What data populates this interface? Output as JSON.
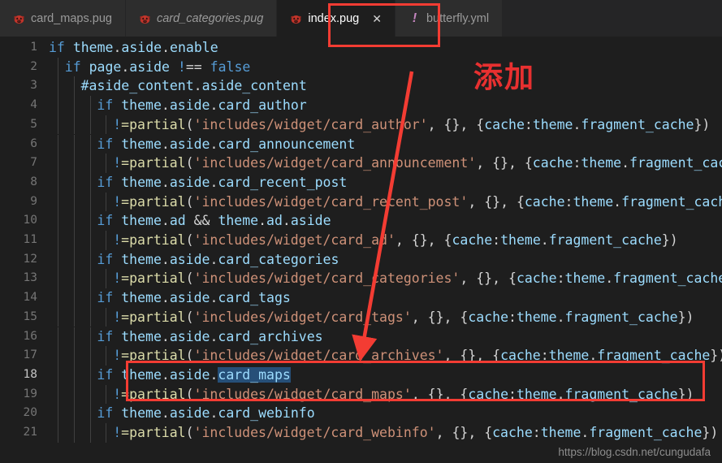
{
  "window": {
    "app": "code-editor",
    "theme_background": "#1e1e1e",
    "accent_red": "#f33c33"
  },
  "tabbar": {
    "tabs": [
      {
        "label": "card_maps.pug",
        "icon": "pug-file-icon",
        "active": false,
        "preview": false,
        "closable": false
      },
      {
        "label": "card_categories.pug",
        "icon": "pug-file-icon",
        "active": false,
        "preview": true,
        "closable": false
      },
      {
        "label": "index.pug",
        "icon": "pug-file-icon",
        "active": true,
        "preview": false,
        "closable": true,
        "close_label": "✕"
      },
      {
        "label": "butterfly.yml",
        "icon": "yaml-file-icon",
        "active": false,
        "preview": false,
        "closable": false
      }
    ]
  },
  "editor": {
    "language": "pug",
    "selection_text": "card_maps",
    "current_line": 18,
    "lines": [
      {
        "n": 1,
        "indent": 0,
        "tokens": [
          {
            "t": "if ",
            "c": "kw"
          },
          {
            "t": "theme",
            "c": "prop"
          },
          {
            "t": ".",
            "c": "op"
          },
          {
            "t": "aside",
            "c": "prop"
          },
          {
            "t": ".",
            "c": "op"
          },
          {
            "t": "enable",
            "c": "prop"
          }
        ]
      },
      {
        "n": 2,
        "indent": 1,
        "tokens": [
          {
            "t": "if ",
            "c": "kw"
          },
          {
            "t": "page",
            "c": "prop"
          },
          {
            "t": ".",
            "c": "op"
          },
          {
            "t": "aside ",
            "c": "prop"
          },
          {
            "t": "!",
            "c": "kw"
          },
          {
            "t": "== ",
            "c": "op"
          },
          {
            "t": "false",
            "c": "kw"
          }
        ]
      },
      {
        "n": 3,
        "indent": 2,
        "tokens": [
          {
            "t": "#aside_content",
            "c": "prop"
          },
          {
            "t": ".",
            "c": "op"
          },
          {
            "t": "aside_content",
            "c": "prop"
          }
        ]
      },
      {
        "n": 4,
        "indent": 3,
        "tokens": [
          {
            "t": "if ",
            "c": "kw"
          },
          {
            "t": "theme",
            "c": "prop"
          },
          {
            "t": ".",
            "c": "op"
          },
          {
            "t": "aside",
            "c": "prop"
          },
          {
            "t": ".",
            "c": "op"
          },
          {
            "t": "card_author",
            "c": "prop"
          }
        ]
      },
      {
        "n": 5,
        "indent": 4,
        "tokens": [
          {
            "t": "!",
            "c": "kw"
          },
          {
            "t": "=",
            "c": "fn"
          },
          {
            "t": "partial",
            "c": "fn"
          },
          {
            "t": "(",
            "c": "punc"
          },
          {
            "t": "'includes/widget/card_author'",
            "c": "str"
          },
          {
            "t": ", ",
            "c": "punc"
          },
          {
            "t": "{}",
            "c": "punc"
          },
          {
            "t": ", ",
            "c": "punc"
          },
          {
            "t": "{",
            "c": "punc"
          },
          {
            "t": "cache",
            "c": "prop"
          },
          {
            "t": ":",
            "c": "op"
          },
          {
            "t": "theme",
            "c": "prop"
          },
          {
            "t": ".",
            "c": "op"
          },
          {
            "t": "fragment_cache",
            "c": "prop"
          },
          {
            "t": "})",
            "c": "punc"
          }
        ]
      },
      {
        "n": 6,
        "indent": 3,
        "tokens": [
          {
            "t": "if ",
            "c": "kw"
          },
          {
            "t": "theme",
            "c": "prop"
          },
          {
            "t": ".",
            "c": "op"
          },
          {
            "t": "aside",
            "c": "prop"
          },
          {
            "t": ".",
            "c": "op"
          },
          {
            "t": "card_announcement",
            "c": "prop"
          }
        ]
      },
      {
        "n": 7,
        "indent": 4,
        "tokens": [
          {
            "t": "!",
            "c": "kw"
          },
          {
            "t": "=",
            "c": "fn"
          },
          {
            "t": "partial",
            "c": "fn"
          },
          {
            "t": "(",
            "c": "punc"
          },
          {
            "t": "'includes/widget/card_announcement'",
            "c": "str"
          },
          {
            "t": ", ",
            "c": "punc"
          },
          {
            "t": "{}",
            "c": "punc"
          },
          {
            "t": ", ",
            "c": "punc"
          },
          {
            "t": "{",
            "c": "punc"
          },
          {
            "t": "cache",
            "c": "prop"
          },
          {
            "t": ":",
            "c": "op"
          },
          {
            "t": "theme",
            "c": "prop"
          },
          {
            "t": ".",
            "c": "op"
          },
          {
            "t": "fragment_cache",
            "c": "prop"
          },
          {
            "t": "})",
            "c": "punc"
          }
        ]
      },
      {
        "n": 8,
        "indent": 3,
        "tokens": [
          {
            "t": "if ",
            "c": "kw"
          },
          {
            "t": "theme",
            "c": "prop"
          },
          {
            "t": ".",
            "c": "op"
          },
          {
            "t": "aside",
            "c": "prop"
          },
          {
            "t": ".",
            "c": "op"
          },
          {
            "t": "card_recent_post",
            "c": "prop"
          }
        ]
      },
      {
        "n": 9,
        "indent": 4,
        "tokens": [
          {
            "t": "!",
            "c": "kw"
          },
          {
            "t": "=",
            "c": "fn"
          },
          {
            "t": "partial",
            "c": "fn"
          },
          {
            "t": "(",
            "c": "punc"
          },
          {
            "t": "'includes/widget/card_recent_post'",
            "c": "str"
          },
          {
            "t": ", ",
            "c": "punc"
          },
          {
            "t": "{}",
            "c": "punc"
          },
          {
            "t": ", ",
            "c": "punc"
          },
          {
            "t": "{",
            "c": "punc"
          },
          {
            "t": "cache",
            "c": "prop"
          },
          {
            "t": ":",
            "c": "op"
          },
          {
            "t": "theme",
            "c": "prop"
          },
          {
            "t": ".",
            "c": "op"
          },
          {
            "t": "fragment_cache",
            "c": "prop"
          },
          {
            "t": "})",
            "c": "punc"
          }
        ]
      },
      {
        "n": 10,
        "indent": 3,
        "tokens": [
          {
            "t": "if ",
            "c": "kw"
          },
          {
            "t": "theme",
            "c": "prop"
          },
          {
            "t": ".",
            "c": "op"
          },
          {
            "t": "ad ",
            "c": "prop"
          },
          {
            "t": "&& ",
            "c": "op"
          },
          {
            "t": "theme",
            "c": "prop"
          },
          {
            "t": ".",
            "c": "op"
          },
          {
            "t": "ad",
            "c": "prop"
          },
          {
            "t": ".",
            "c": "op"
          },
          {
            "t": "aside",
            "c": "prop"
          }
        ]
      },
      {
        "n": 11,
        "indent": 4,
        "tokens": [
          {
            "t": "!",
            "c": "kw"
          },
          {
            "t": "=",
            "c": "fn"
          },
          {
            "t": "partial",
            "c": "fn"
          },
          {
            "t": "(",
            "c": "punc"
          },
          {
            "t": "'includes/widget/card_ad'",
            "c": "str"
          },
          {
            "t": ", ",
            "c": "punc"
          },
          {
            "t": "{}",
            "c": "punc"
          },
          {
            "t": ", ",
            "c": "punc"
          },
          {
            "t": "{",
            "c": "punc"
          },
          {
            "t": "cache",
            "c": "prop"
          },
          {
            "t": ":",
            "c": "op"
          },
          {
            "t": "theme",
            "c": "prop"
          },
          {
            "t": ".",
            "c": "op"
          },
          {
            "t": "fragment_cache",
            "c": "prop"
          },
          {
            "t": "})",
            "c": "punc"
          }
        ]
      },
      {
        "n": 12,
        "indent": 3,
        "tokens": [
          {
            "t": "if ",
            "c": "kw"
          },
          {
            "t": "theme",
            "c": "prop"
          },
          {
            "t": ".",
            "c": "op"
          },
          {
            "t": "aside",
            "c": "prop"
          },
          {
            "t": ".",
            "c": "op"
          },
          {
            "t": "card_categories",
            "c": "prop"
          }
        ]
      },
      {
        "n": 13,
        "indent": 4,
        "tokens": [
          {
            "t": "!",
            "c": "kw"
          },
          {
            "t": "=",
            "c": "fn"
          },
          {
            "t": "partial",
            "c": "fn"
          },
          {
            "t": "(",
            "c": "punc"
          },
          {
            "t": "'includes/widget/card_categories'",
            "c": "str"
          },
          {
            "t": ", ",
            "c": "punc"
          },
          {
            "t": "{}",
            "c": "punc"
          },
          {
            "t": ", ",
            "c": "punc"
          },
          {
            "t": "{",
            "c": "punc"
          },
          {
            "t": "cache",
            "c": "prop"
          },
          {
            "t": ":",
            "c": "op"
          },
          {
            "t": "theme",
            "c": "prop"
          },
          {
            "t": ".",
            "c": "op"
          },
          {
            "t": "fragment_cache",
            "c": "prop"
          },
          {
            "t": "})",
            "c": "punc"
          }
        ]
      },
      {
        "n": 14,
        "indent": 3,
        "tokens": [
          {
            "t": "if ",
            "c": "kw"
          },
          {
            "t": "theme",
            "c": "prop"
          },
          {
            "t": ".",
            "c": "op"
          },
          {
            "t": "aside",
            "c": "prop"
          },
          {
            "t": ".",
            "c": "op"
          },
          {
            "t": "card_tags",
            "c": "prop"
          }
        ]
      },
      {
        "n": 15,
        "indent": 4,
        "tokens": [
          {
            "t": "!",
            "c": "kw"
          },
          {
            "t": "=",
            "c": "fn"
          },
          {
            "t": "partial",
            "c": "fn"
          },
          {
            "t": "(",
            "c": "punc"
          },
          {
            "t": "'includes/widget/card_tags'",
            "c": "str"
          },
          {
            "t": ", ",
            "c": "punc"
          },
          {
            "t": "{}",
            "c": "punc"
          },
          {
            "t": ", ",
            "c": "punc"
          },
          {
            "t": "{",
            "c": "punc"
          },
          {
            "t": "cache",
            "c": "prop"
          },
          {
            "t": ":",
            "c": "op"
          },
          {
            "t": "theme",
            "c": "prop"
          },
          {
            "t": ".",
            "c": "op"
          },
          {
            "t": "fragment_cache",
            "c": "prop"
          },
          {
            "t": "})",
            "c": "punc"
          }
        ]
      },
      {
        "n": 16,
        "indent": 3,
        "tokens": [
          {
            "t": "if ",
            "c": "kw"
          },
          {
            "t": "theme",
            "c": "prop"
          },
          {
            "t": ".",
            "c": "op"
          },
          {
            "t": "aside",
            "c": "prop"
          },
          {
            "t": ".",
            "c": "op"
          },
          {
            "t": "card_archives",
            "c": "prop"
          }
        ]
      },
      {
        "n": 17,
        "indent": 4,
        "tokens": [
          {
            "t": "!",
            "c": "kw"
          },
          {
            "t": "=",
            "c": "fn"
          },
          {
            "t": "partial",
            "c": "fn"
          },
          {
            "t": "(",
            "c": "punc"
          },
          {
            "t": "'includes/widget/card_archives'",
            "c": "str"
          },
          {
            "t": ", ",
            "c": "punc"
          },
          {
            "t": "{}",
            "c": "punc"
          },
          {
            "t": ", ",
            "c": "punc"
          },
          {
            "t": "{",
            "c": "punc"
          },
          {
            "t": "cache",
            "c": "prop"
          },
          {
            "t": ":",
            "c": "op"
          },
          {
            "t": "theme",
            "c": "prop"
          },
          {
            "t": ".",
            "c": "op"
          },
          {
            "t": "fragment_cache",
            "c": "prop"
          },
          {
            "t": "})",
            "c": "punc"
          }
        ]
      },
      {
        "n": 18,
        "indent": 3,
        "tokens": [
          {
            "t": "if ",
            "c": "kw"
          },
          {
            "t": "theme",
            "c": "prop"
          },
          {
            "t": ".",
            "c": "op"
          },
          {
            "t": "aside",
            "c": "prop"
          },
          {
            "t": ".",
            "c": "op"
          },
          {
            "t": "card_maps",
            "c": "prop sel"
          }
        ]
      },
      {
        "n": 19,
        "indent": 4,
        "tokens": [
          {
            "t": "!",
            "c": "kw"
          },
          {
            "t": "=",
            "c": "fn"
          },
          {
            "t": "partial",
            "c": "fn"
          },
          {
            "t": "(",
            "c": "punc"
          },
          {
            "t": "'includes/widget/card_maps'",
            "c": "str"
          },
          {
            "t": ", ",
            "c": "punc"
          },
          {
            "t": "{}",
            "c": "punc"
          },
          {
            "t": ", ",
            "c": "punc"
          },
          {
            "t": "{",
            "c": "punc"
          },
          {
            "t": "cache",
            "c": "prop"
          },
          {
            "t": ":",
            "c": "op"
          },
          {
            "t": "theme",
            "c": "prop"
          },
          {
            "t": ".",
            "c": "op"
          },
          {
            "t": "fragment_cache",
            "c": "prop"
          },
          {
            "t": "})",
            "c": "punc"
          }
        ]
      },
      {
        "n": 20,
        "indent": 3,
        "tokens": [
          {
            "t": "if ",
            "c": "kw"
          },
          {
            "t": "theme",
            "c": "prop"
          },
          {
            "t": ".",
            "c": "op"
          },
          {
            "t": "aside",
            "c": "prop"
          },
          {
            "t": ".",
            "c": "op"
          },
          {
            "t": "card_webinfo",
            "c": "prop"
          }
        ]
      },
      {
        "n": 21,
        "indent": 4,
        "tokens": [
          {
            "t": "!",
            "c": "kw"
          },
          {
            "t": "=",
            "c": "fn"
          },
          {
            "t": "partial",
            "c": "fn"
          },
          {
            "t": "(",
            "c": "punc"
          },
          {
            "t": "'includes/widget/card_webinfo'",
            "c": "str"
          },
          {
            "t": ", ",
            "c": "punc"
          },
          {
            "t": "{}",
            "c": "punc"
          },
          {
            "t": ", ",
            "c": "punc"
          },
          {
            "t": "{",
            "c": "punc"
          },
          {
            "t": "cache",
            "c": "prop"
          },
          {
            "t": ":",
            "c": "op"
          },
          {
            "t": "theme",
            "c": "prop"
          },
          {
            "t": ".",
            "c": "op"
          },
          {
            "t": "fragment_cache",
            "c": "prop"
          },
          {
            "t": "})",
            "c": "punc"
          }
        ]
      }
    ]
  },
  "annotations": {
    "note_text": "添加",
    "note_color": "#e83030",
    "highlight_boxes": [
      {
        "name": "tab-highlight",
        "target": "index.pug tab"
      },
      {
        "name": "code-highlight",
        "target": "lines 18-19 card_maps block"
      }
    ],
    "arrow": {
      "name": "pointer-arrow",
      "from": "note",
      "to": "code-highlight"
    }
  },
  "watermark": {
    "text": "https://blog.csdn.net/cungudafa"
  }
}
